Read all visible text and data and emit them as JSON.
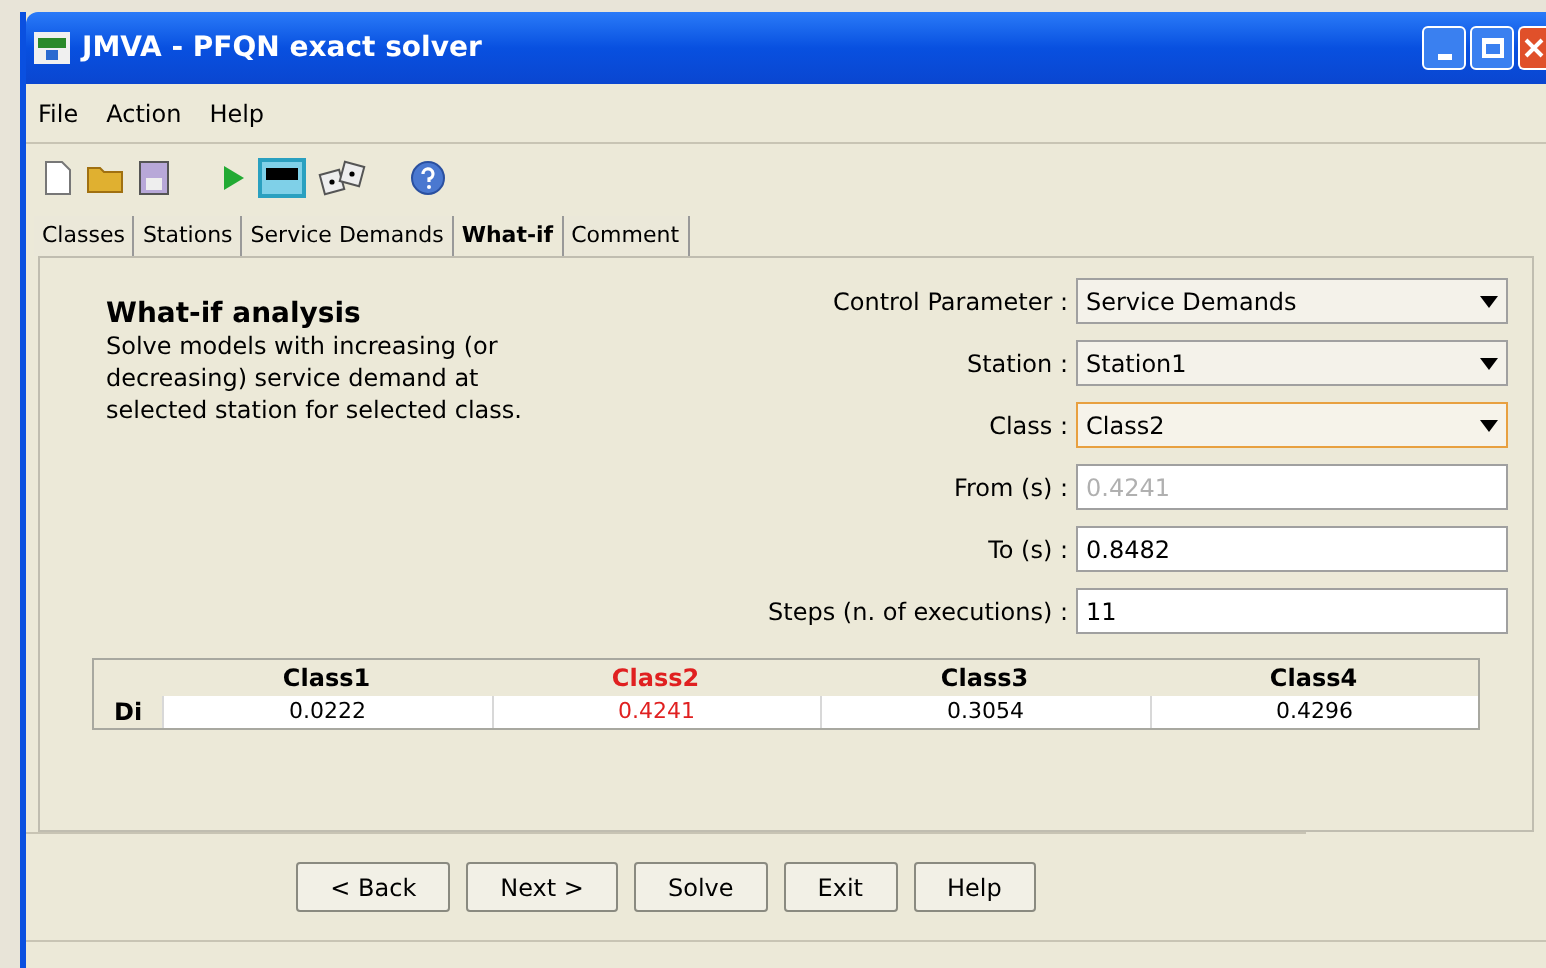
{
  "window": {
    "title": "JMVA - PFQN exact solver"
  },
  "menu": [
    "File",
    "Action",
    "Help"
  ],
  "tabs": [
    {
      "label": "Classes",
      "selected": false
    },
    {
      "label": "Stations",
      "selected": false
    },
    {
      "label": "Service Demands",
      "selected": false
    },
    {
      "label": "What-if",
      "selected": true
    },
    {
      "label": "Comment",
      "selected": false
    }
  ],
  "intro": {
    "title": "What-if analysis",
    "text": "Solve models with increasing (or decreasing) service demand at selected station for selected class."
  },
  "form": [
    {
      "kind": "select",
      "label": "Control Parameter :",
      "value": "Service Demands",
      "focused": false,
      "disabled": false
    },
    {
      "kind": "select",
      "label": "Station :",
      "value": "Station1",
      "focused": false,
      "disabled": false
    },
    {
      "kind": "select",
      "label": "Class :",
      "value": "Class2",
      "focused": true,
      "disabled": false
    },
    {
      "kind": "text",
      "label": "From (s) :",
      "value": "0.4241",
      "focused": false,
      "disabled": true
    },
    {
      "kind": "text",
      "label": "To (s) :",
      "value": "0.8482",
      "focused": false,
      "disabled": false
    },
    {
      "kind": "text",
      "label": "Steps (n. of executions) :",
      "value": "11",
      "focused": false,
      "disabled": false
    }
  ],
  "table": {
    "row_label": "Di",
    "columns": [
      {
        "name": "Class1",
        "value": "0.0222",
        "selected": false
      },
      {
        "name": "Class2",
        "value": "0.4241",
        "selected": true
      },
      {
        "name": "Class3",
        "value": "0.3054",
        "selected": false
      },
      {
        "name": "Class4",
        "value": "0.4296",
        "selected": false
      }
    ]
  },
  "buttons": [
    "< Back",
    "Next >",
    "Solve",
    "Exit",
    "Help"
  ]
}
